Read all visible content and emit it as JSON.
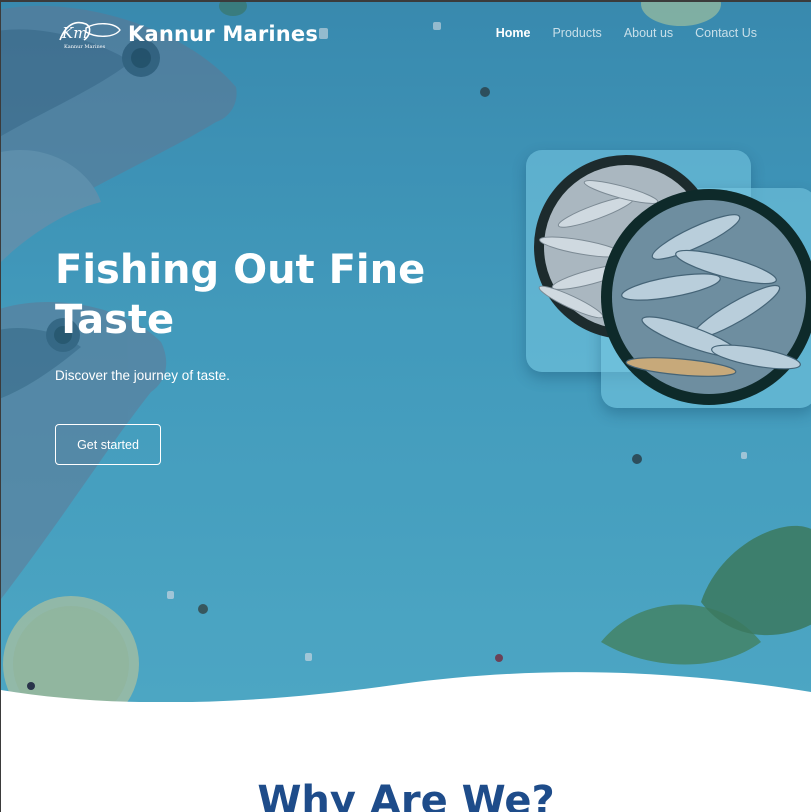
{
  "brand": {
    "name": "Kannur Marines",
    "logo_text": "Kannur Marines",
    "logo_initials": "Km"
  },
  "nav": {
    "items": [
      {
        "label": "Home",
        "active": true
      },
      {
        "label": "Products",
        "active": false
      },
      {
        "label": "About us",
        "active": false
      },
      {
        "label": "Contact Us",
        "active": false
      }
    ]
  },
  "hero": {
    "headline": "Fishing Out Fine Taste",
    "tagline": "Discover the journey of taste.",
    "cta_label": "Get started"
  },
  "next_section": {
    "heading": "Why Are We?"
  },
  "colors": {
    "hero": "#48a6c4",
    "heading": "#1e4c8a",
    "text": "#ffffff"
  }
}
